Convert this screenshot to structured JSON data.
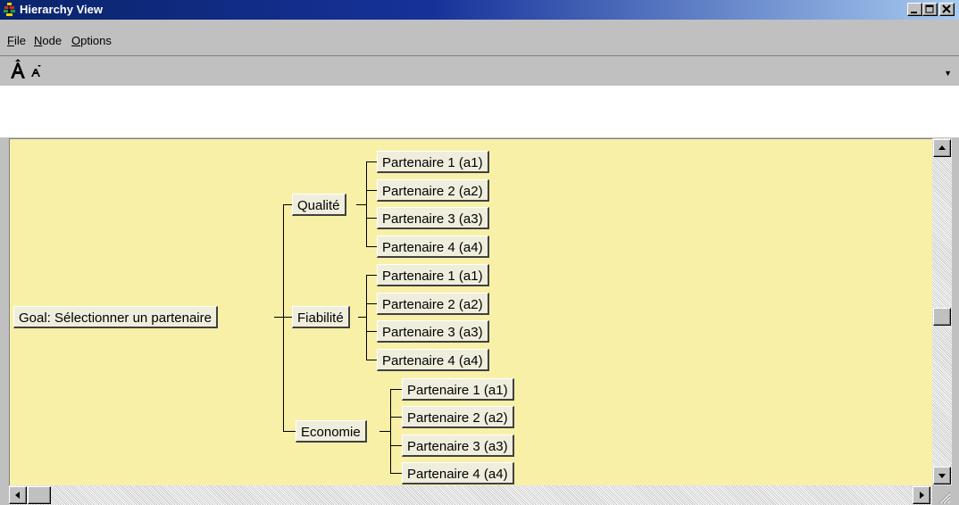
{
  "window": {
    "title": "Hierarchy View"
  },
  "menu": {
    "items": [
      {
        "label_prefix": "",
        "accel": "F",
        "label_rest": "ile"
      },
      {
        "label_prefix": "",
        "accel": "N",
        "label_rest": "ode"
      },
      {
        "label_prefix": "",
        "accel": "O",
        "label_rest": "ptions"
      }
    ]
  },
  "toolbar": {
    "increase_font_icon": "font-increase-icon",
    "decrease_font_icon": "font-decrease-icon"
  },
  "hierarchy": {
    "goal": "Goal: Sélectionner un partenaire",
    "criteria": [
      {
        "label": "Qualité",
        "alternatives": [
          "Partenaire 1 (a1)",
          "Partenaire 2 (a2)",
          "Partenaire 3 (a3)",
          "Partenaire 4 (a4)"
        ]
      },
      {
        "label": "Fiabilité",
        "alternatives": [
          "Partenaire 1 (a1)",
          "Partenaire 2 (a2)",
          "Partenaire 3 (a3)",
          "Partenaire 4 (a4)"
        ]
      },
      {
        "label": "Economie",
        "alternatives": [
          "Partenaire 1 (a1)",
          "Partenaire 2 (a2)",
          "Partenaire 3 (a3)",
          "Partenaire 4 (a4)"
        ]
      }
    ]
  },
  "colors": {
    "canvas_bg": "#f9f0a8",
    "node_bg": "#efeedd",
    "title_bar": "#0a246a"
  }
}
